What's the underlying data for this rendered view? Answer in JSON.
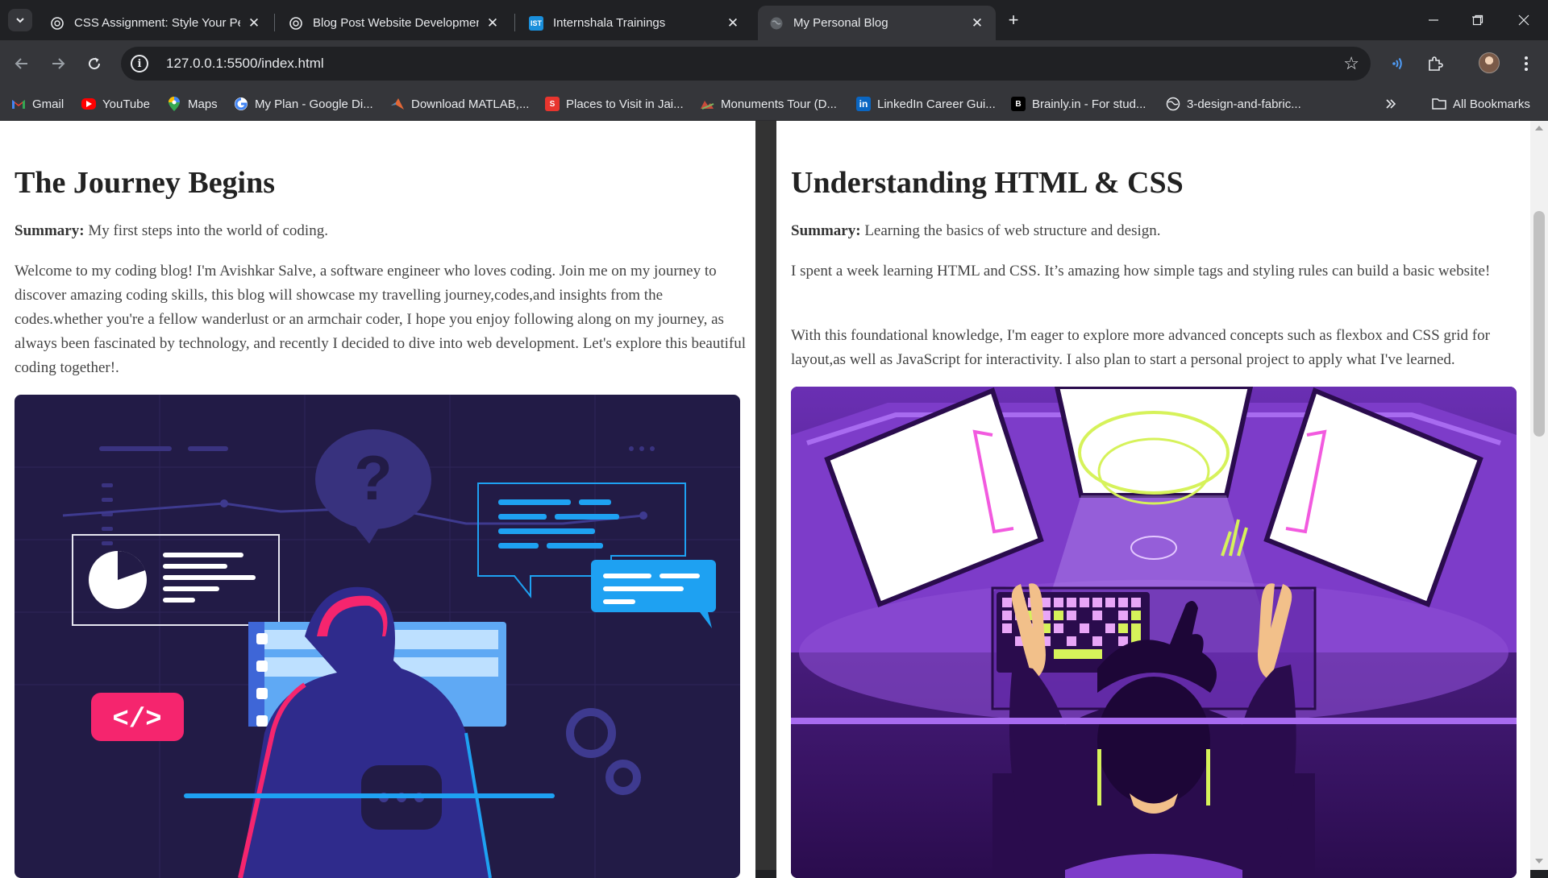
{
  "browser": {
    "tabs": [
      {
        "title": "CSS Assignment: Style Your Pers",
        "icon": "openai-icon"
      },
      {
        "title": "Blog Post Website Developmen",
        "icon": "openai-icon"
      },
      {
        "title": "Internshala Trainings",
        "icon": "internshala-icon",
        "badge": "IST"
      },
      {
        "title": "My Personal Blog",
        "icon": "globe-icon",
        "active": true
      }
    ],
    "new_tab_symbol": "+",
    "url": "127.0.0.1:5500/index.html",
    "bookmarks": [
      {
        "label": "Gmail",
        "icon": "gmail-icon"
      },
      {
        "label": "YouTube",
        "icon": "youtube-icon"
      },
      {
        "label": "Maps",
        "icon": "maps-icon"
      },
      {
        "label": "My Plan - Google Di...",
        "icon": "google-icon"
      },
      {
        "label": "Download MATLAB,...",
        "icon": "matlab-icon"
      },
      {
        "label": "Places to Visit in Jai...",
        "icon": "places-icon"
      },
      {
        "label": "Monuments Tour (D...",
        "icon": "monuments-icon"
      },
      {
        "label": "LinkedIn Career Gui...",
        "icon": "linkedin-icon"
      },
      {
        "label": "Brainly.in - For stud...",
        "icon": "brainly-icon"
      },
      {
        "label": "3-design-and-fabric...",
        "icon": "globe-icon"
      }
    ],
    "all_bookmarks_label": "All Bookmarks"
  },
  "posts": [
    {
      "title": "The Journey Begins",
      "summary_label": "Summary:",
      "summary": " My first steps into the world of coding.",
      "paragraphs": [
        "Welcome to my coding blog! I'm Avishkar Salve, a software engineer who loves coding. Join me on my journey to discover amazing coding skills, this blog will showcase my travelling journey,codes,and insights from the codes.whether you're a fellow wanderlust or an armchair coder, I hope you enjoy following along on my journey, as always been fascinated by technology, and recently I decided to dive into web development. Let's explore this beautiful coding together!."
      ],
      "image": {
        "code_tag": "</>",
        "question_mark": "?"
      }
    },
    {
      "title": "Understanding HTML & CSS",
      "summary_label": "Summary:",
      "summary": " Learning the basics of web structure and design.",
      "paragraphs": [
        "I spent a week learning HTML and CSS. It’s amazing how simple tags and styling rules can build a basic website!",
        "With this foundational knowledge, I'm eager to explore more advanced concepts such as flexbox and CSS grid for layout,as well as JavaScript for interactivity. I also plan to start a personal project to apply what I've learned."
      ]
    }
  ],
  "colors": {
    "chrome_dark": "#202124",
    "chrome_toolbar": "#35363a",
    "page_gap": "#333333",
    "illustration1_bg": "#221b46",
    "illustration2_bg": "#3b1466"
  }
}
